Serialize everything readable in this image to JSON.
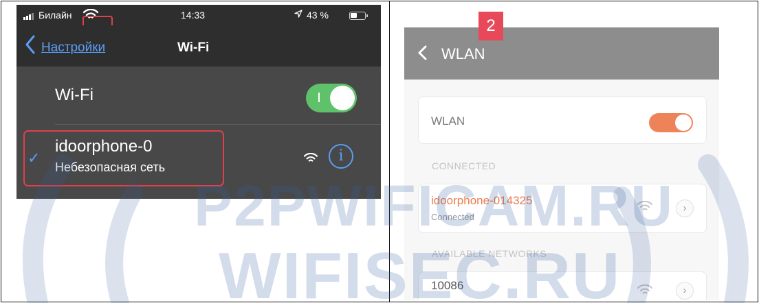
{
  "ios": {
    "status": {
      "carrier": "Билайн",
      "time": "14:33",
      "battery": "43 %"
    },
    "nav": {
      "back_label": "Настройки",
      "title": "Wi-Fi"
    },
    "wifi_row": {
      "label": "Wi-Fi",
      "toggle_on": true
    },
    "network": {
      "name": "idoorphone-0",
      "security": "Небезопасная сеть",
      "info_symbol": "i"
    }
  },
  "android": {
    "badge": "2",
    "title": "WLAN",
    "wlan_label": "WLAN",
    "toggle_on": true,
    "section_connected": "CONNECTED",
    "connected": {
      "name": "idoorphone-014325",
      "status": "Connected"
    },
    "section_available": "AVAILABLE NETWORKS",
    "available": [
      {
        "name": "10086",
        "detail": ""
      }
    ]
  },
  "watermark": {
    "line1": "P2PWIFICAM.RU",
    "line2": "WIFISEC.RU"
  },
  "colors": {
    "ios_blue": "#5a9df5",
    "ios_green": "#5fc16a",
    "highlight_red": "#e0404a",
    "android_orange": "#ee8359"
  },
  "icons": [
    "signal-bars-icon",
    "wifi-icon",
    "location-arrow-icon",
    "battery-icon",
    "chevron-left-icon",
    "checkmark-icon",
    "info-icon",
    "chevron-right-icon"
  ]
}
